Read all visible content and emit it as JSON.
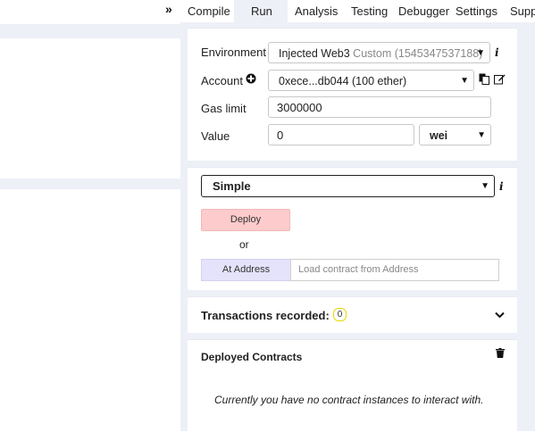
{
  "nav": {
    "expand_icon": "»",
    "tabs": [
      "Compile",
      "Run",
      "Analysis",
      "Testing",
      "Debugger",
      "Settings",
      "Supp"
    ],
    "active_tab": "Run"
  },
  "environment": {
    "label": "Environment",
    "value_main": "Injected Web3",
    "value_sub": "Custom (1545347537188)"
  },
  "account": {
    "label": "Account",
    "value": "0xece...db044 (100 ether)"
  },
  "gas_limit": {
    "label": "Gas limit",
    "value": "3000000"
  },
  "value_field": {
    "label": "Value",
    "value": "0",
    "unit": "wei"
  },
  "contract": {
    "selected": "Simple",
    "deploy_label": "Deploy",
    "or_label": "or",
    "at_address_label": "At Address",
    "address_placeholder": "Load contract from Address"
  },
  "transactions": {
    "label": "Transactions recorded:",
    "count": "0"
  },
  "deployed": {
    "title": "Deployed Contracts",
    "empty_message": "Currently you have no contract instances to interact with."
  },
  "colors": {
    "gutter": "#eef0f8",
    "deploy_bg": "#fdcbcb",
    "at_address_bg": "#e4e3fb",
    "badge": "#e8d800"
  }
}
